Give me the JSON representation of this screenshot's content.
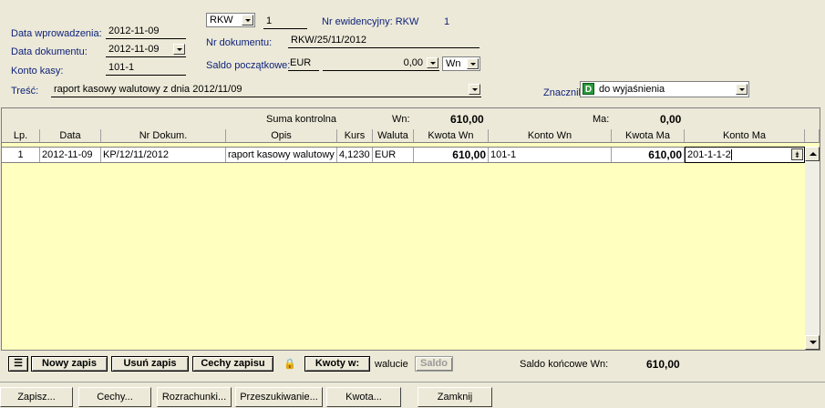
{
  "header": {
    "data_wprowadzenia_label": "Data wprowadzenia:",
    "data_wprowadzenia": "2012-11-09",
    "data_dokumentu_label": "Data dokumentu:",
    "data_dokumentu": "2012-11-09",
    "konto_kasy_label": "Konto kasy:",
    "konto_kasy": "101-1",
    "tresc_label": "Treść:",
    "tresc": "raport kasowy walutowy z dnia 2012/11/09",
    "doc_type": "RKW",
    "doc_number": "1",
    "nr_ewidencyjny_label": "Nr ewidencyjny: RKW",
    "nr_ewidencyjny_value": "1",
    "nr_dokumentu_label": "Nr dokumentu:",
    "nr_dokumentu": "RKW/25/11/2012",
    "saldo_label": "Saldo początkowe:",
    "saldo_currency": "EUR",
    "saldo_value": "0,00",
    "saldo_side": "Wn",
    "znacznik_label": "Znacznik:",
    "znacznik_badge": "D",
    "znacznik_value": "do wyjaśnienia"
  },
  "summary": {
    "suma_label": "Suma kontrolna",
    "wn_label": "Wn:",
    "wn_value": "610,00",
    "ma_label": "Ma:",
    "ma_value": "0,00"
  },
  "columns": [
    "Lp.",
    "Data",
    "Nr Dokum.",
    "Opis",
    "Kurs",
    "Waluta",
    "Kwota Wn",
    "Konto Wn",
    "Kwota Ma",
    "Konto Ma"
  ],
  "rows": [
    {
      "lp": "1",
      "data": "2012-11-09",
      "nr": "KP/12/11/2012",
      "opis": "raport kasowy walutowy",
      "kurs": "4,1230",
      "waluta": "EUR",
      "kwota_wn": "610,00",
      "konto_wn": "101-1",
      "kwota_ma": "610,00",
      "konto_ma": "201-1-1-2"
    }
  ],
  "toolbar": {
    "nowy": "Nowy zapis",
    "usun": "Usuń zapis",
    "cechy_zapisu": "Cechy zapisu",
    "kwoty": "Kwoty w:",
    "walucie": "walucie",
    "saldo": "Saldo",
    "saldo_koncowe_label": "Saldo końcowe Wn:",
    "saldo_koncowe_value": "610,00"
  },
  "bottom": {
    "zapisz": "Zapisz...",
    "cechy": "Cechy...",
    "rozrachunki": "Rozrachunki...",
    "przeszukiwanie": "Przeszukiwanie...",
    "kwota": "Kwota...",
    "zamknij": "Zamknij"
  },
  "colors": {
    "grid_bg": "#ffffc0",
    "window_bg": "#ece9d8",
    "label_navy": "#0b1f7a",
    "badge_green": "#2a9a3a"
  }
}
